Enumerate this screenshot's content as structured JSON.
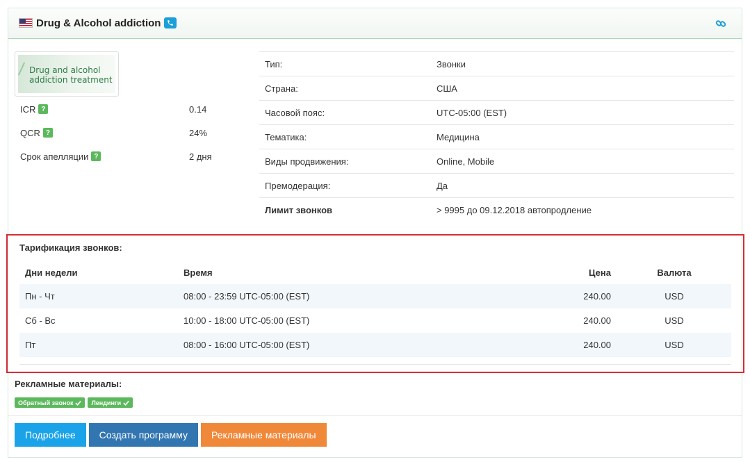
{
  "header": {
    "title": "Drug & Alcohol addiction"
  },
  "logo": {
    "line1": "Drug and alcohol",
    "line2": "addiction treatment"
  },
  "metrics": [
    {
      "label": "ICR",
      "value": "0.14",
      "help": "?"
    },
    {
      "label": "QCR",
      "value": "24%",
      "help": "?"
    },
    {
      "label": "Срок апелляции",
      "value": "2 дня",
      "help": "?"
    }
  ],
  "info": [
    {
      "label": "Тип:",
      "value": "Звонки"
    },
    {
      "label": "Страна:",
      "value": "США"
    },
    {
      "label": "Часовой пояс:",
      "value": "UTC-05:00 (EST)"
    },
    {
      "label": "Тематика:",
      "value": "Медицина"
    },
    {
      "label": "Виды продвижения:",
      "value": "Online, Mobile"
    },
    {
      "label": "Премодерация:",
      "value": "Да"
    },
    {
      "label": "Лимит звонков",
      "value": "> 9995 до 09.12.2018 автопродление"
    }
  ],
  "tariff": {
    "title": "Тарификация звонков:",
    "columns": [
      "Дни недели",
      "Время",
      "Цена",
      "Валюта"
    ],
    "rows": [
      {
        "days": "Пн - Чт",
        "time": "08:00 - 23:59 UTC-05:00 (EST)",
        "price": "240.00",
        "currency": "USD"
      },
      {
        "days": "Сб - Вс",
        "time": "10:00 - 18:00 UTC-05:00 (EST)",
        "price": "240.00",
        "currency": "USD"
      },
      {
        "days": "Пт",
        "time": "08:00 - 16:00 UTC-05:00 (EST)",
        "price": "240.00",
        "currency": "USD"
      }
    ]
  },
  "promo": {
    "title": "Рекламные материалы:",
    "tags": [
      "Обратный звонок",
      "Лендинги"
    ]
  },
  "buttons": {
    "details": "Подробнее",
    "create_program": "Создать программу",
    "materials": "Рекламные материалы"
  },
  "colors": {
    "accent_blue": "#1aa3e8",
    "dark_blue": "#3276b1",
    "orange": "#f0883a",
    "green_badge": "#5cb85c",
    "highlight_red": "#d62c35"
  },
  "icons": {
    "flag": "us-flag-icon",
    "phone": "phone-icon",
    "link": "link-icon",
    "check": "check-icon"
  }
}
